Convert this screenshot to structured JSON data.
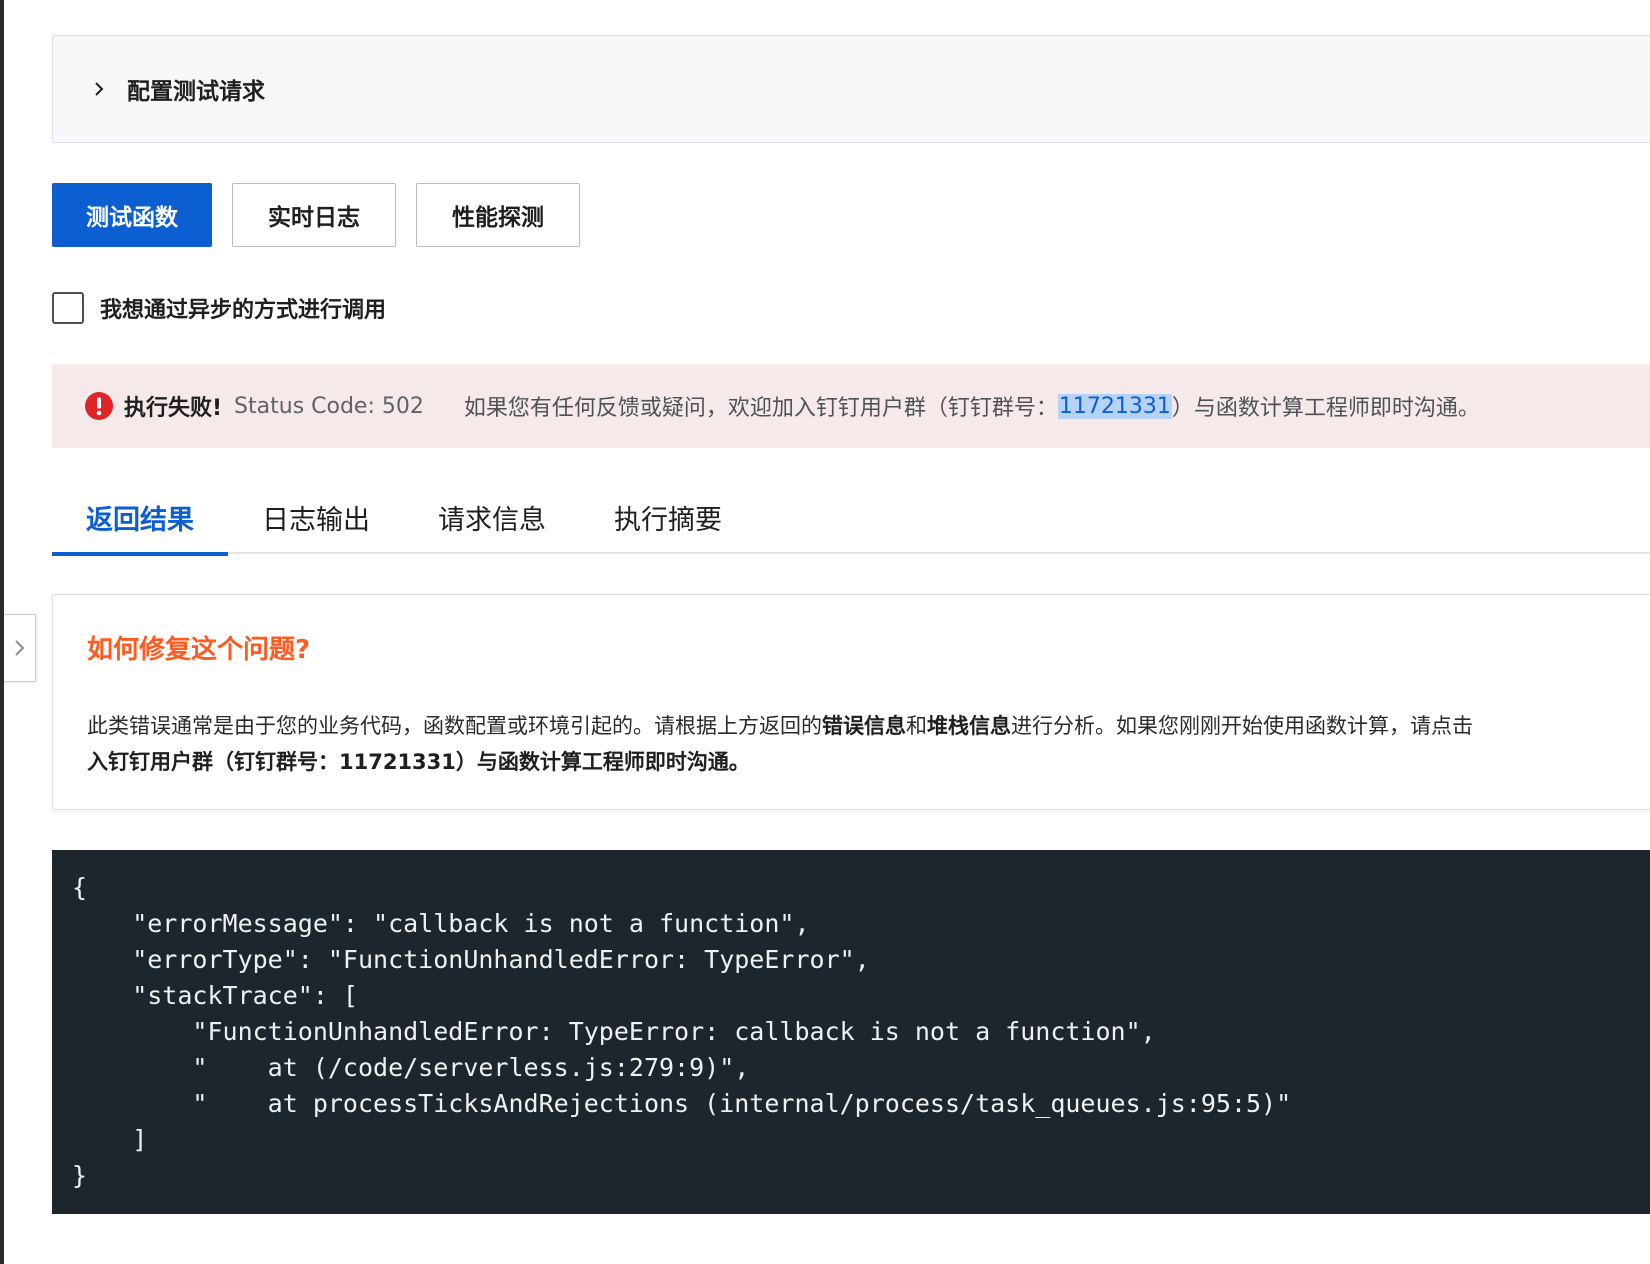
{
  "collapse_panel": {
    "title": "配置测试请求"
  },
  "actions": {
    "test_function": "测试函数",
    "realtime_logs": "实时日志",
    "performance_probe": "性能探测"
  },
  "async_checkbox": {
    "label": "我想通过异步的方式进行调用",
    "checked": false
  },
  "alert": {
    "fail_label": "执行失败!",
    "status": "Status Code: 502",
    "message_prefix": "如果您有任何反馈或疑问，欢迎加入钉钉用户群（钉钉群号：",
    "group_number": "11721331",
    "message_suffix": "）与函数计算工程师即时沟通。"
  },
  "tabs": [
    {
      "label": "返回结果",
      "active": true
    },
    {
      "label": "日志输出",
      "active": false
    },
    {
      "label": "请求信息",
      "active": false
    },
    {
      "label": "执行摘要",
      "active": false
    }
  ],
  "fix": {
    "title": "如何修复这个问题?",
    "line1_a": "此类错误通常是由于您的业务代码，函数配置或环境引起的。请根据上方返回的",
    "line1_b": "错误信息",
    "line1_c": "和",
    "line1_d": "堆栈信息",
    "line1_e": "进行分析。如果您刚刚开始使用函数计算，请点击",
    "line2": "入钉钉用户群（钉钉群号：11721331）与函数计算工程师即时沟通。"
  },
  "code": {
    "lines": [
      "{",
      "    \"errorMessage\": \"callback is not a function\",",
      "    \"errorType\": \"FunctionUnhandledError: TypeError\",",
      "    \"stackTrace\": [",
      "        \"FunctionUnhandledError: TypeError: callback is not a function\",",
      "        \"    at (/code/serverless.js:279:9)\",",
      "        \"    at processTicksAndRejections (internal/process/task_queues.js:95:5)\"",
      "    ]",
      "}"
    ]
  },
  "colors": {
    "primary": "#0b5fd3",
    "error": "#e0252a",
    "warning_title": "#ff5a1f",
    "alert_bg": "#f6e9ea",
    "code_bg": "#1d262c"
  },
  "icons": {
    "collapse": "chevron-right-icon",
    "alert": "error-circle-icon",
    "side_toggle": "chevron-right-icon"
  }
}
